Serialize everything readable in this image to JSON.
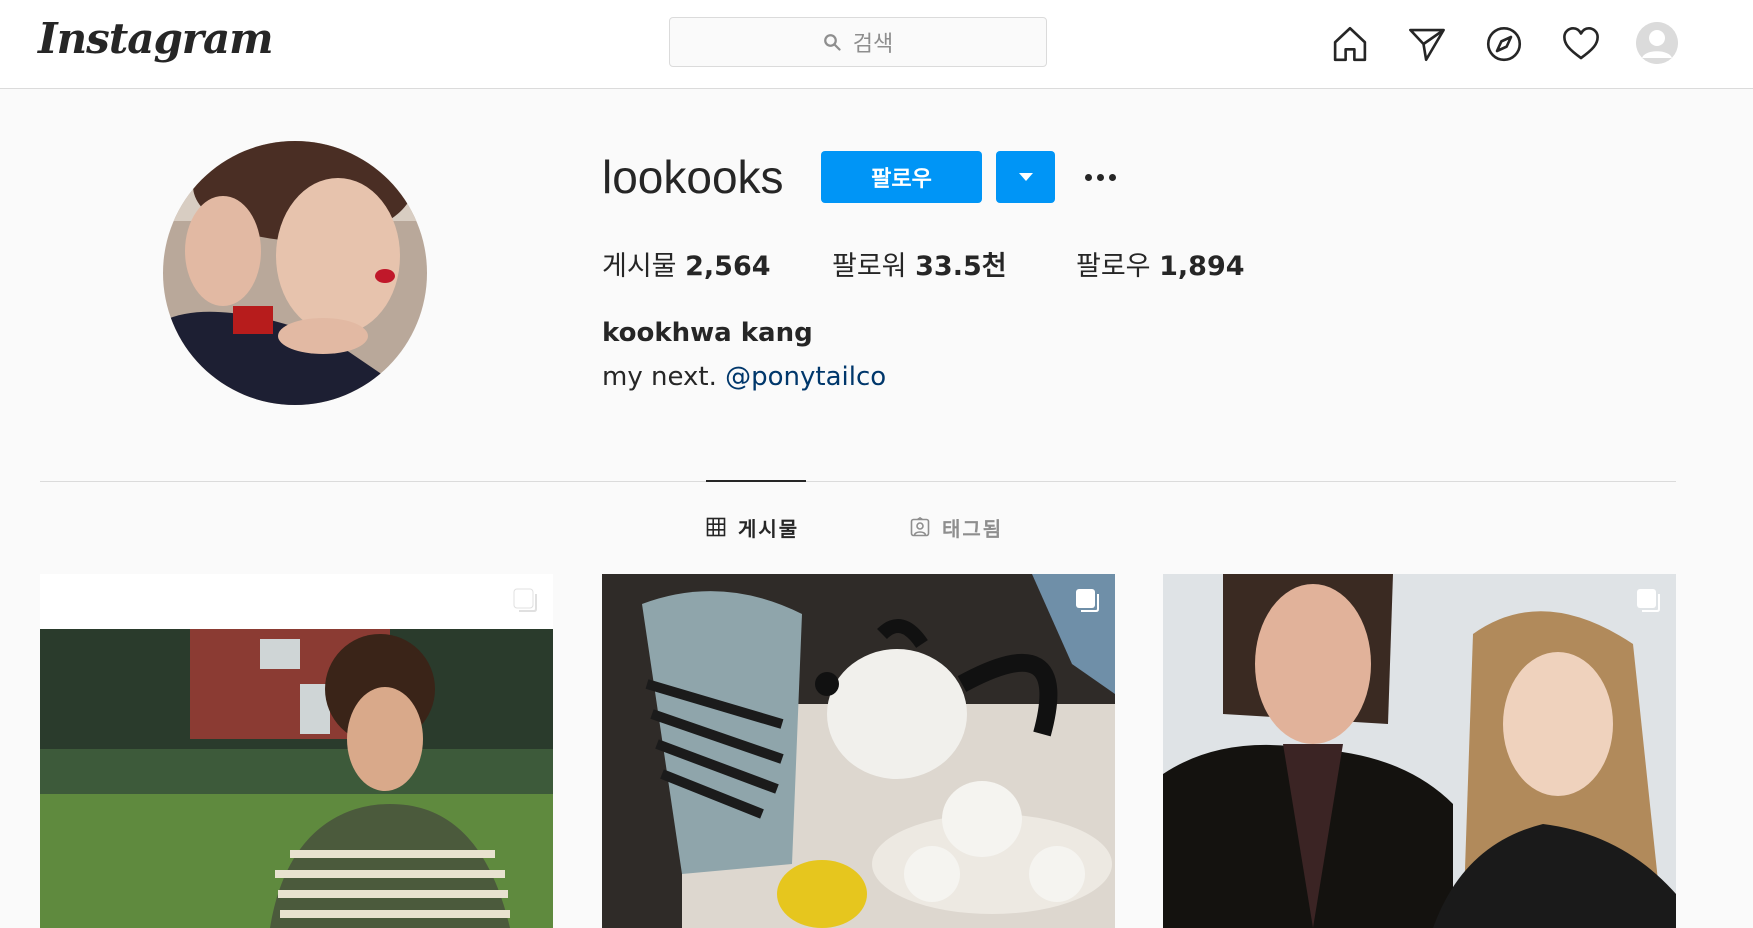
{
  "topbar": {
    "logo": "Instagram",
    "search_placeholder": "검색",
    "icons": [
      "home-icon",
      "direct-icon",
      "explore-icon",
      "activity-icon",
      "profile-avatar"
    ]
  },
  "profile": {
    "username": "lookooks",
    "follow_label": "팔로우",
    "stats": [
      {
        "label": "게시물",
        "value": "2,564"
      },
      {
        "label": "팔로워",
        "value": "33.5천"
      },
      {
        "label": "팔로우",
        "value": "1,894"
      }
    ],
    "full_name": "kookhwa kang",
    "bio_text": "my next.",
    "bio_link": "@ponytailco"
  },
  "tabs": [
    {
      "label": "게시물",
      "icon": "grid-icon",
      "active": true
    },
    {
      "label": "태그됨",
      "icon": "tagged-icon",
      "active": false
    }
  ],
  "colors": {
    "accent": "#0095f6",
    "link": "#00376b",
    "text": "#262626",
    "muted": "#8e8e8e",
    "border": "#dbdbdb",
    "background": "#fafafa"
  }
}
